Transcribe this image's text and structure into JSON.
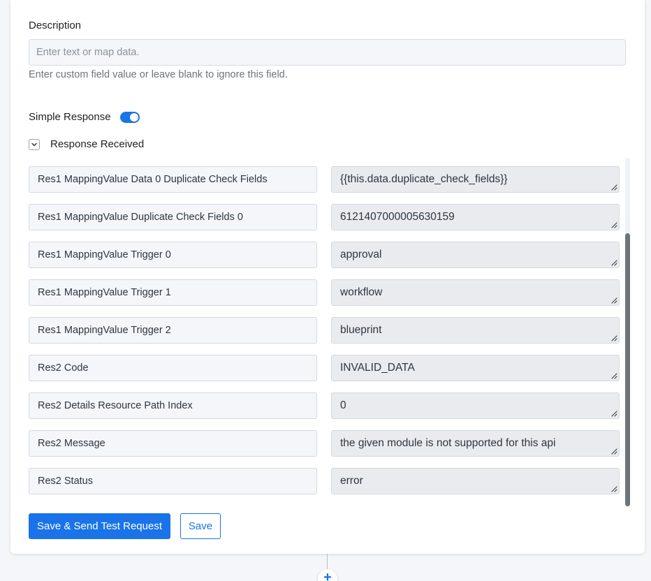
{
  "description": {
    "label": "Description",
    "placeholder": "Enter text or map data.",
    "value": "",
    "help": "Enter custom field value or leave blank to ignore this field."
  },
  "simple_response": {
    "label": "Simple Response",
    "enabled": true
  },
  "response_received": {
    "label": "Response Received",
    "expanded": true
  },
  "rows": [
    {
      "key": "Res1 MappingValue Data 0 Duplicate Check Fields",
      "value": "{{this.data.duplicate_check_fields}}"
    },
    {
      "key": "Res1 MappingValue Duplicate Check Fields 0",
      "value": "6121407000005630159"
    },
    {
      "key": "Res1 MappingValue Trigger 0",
      "value": "approval"
    },
    {
      "key": "Res1 MappingValue Trigger 1",
      "value": "workflow"
    },
    {
      "key": "Res1 MappingValue Trigger 2",
      "value": "blueprint"
    },
    {
      "key": "Res2 Code",
      "value": "INVALID_DATA"
    },
    {
      "key": "Res2 Details Resource Path Index",
      "value": "0"
    },
    {
      "key": "Res2 Message",
      "value": "the given module is not supported for this api"
    },
    {
      "key": "Res2 Status",
      "value": "error"
    }
  ],
  "buttons": {
    "save_and_send": "Save & Send Test Request",
    "save": "Save"
  },
  "add_step": {
    "icon": "plus-icon",
    "glyph": "+"
  },
  "colors": {
    "accent": "#1a73e8",
    "page_bg": "#f4f6f9"
  }
}
